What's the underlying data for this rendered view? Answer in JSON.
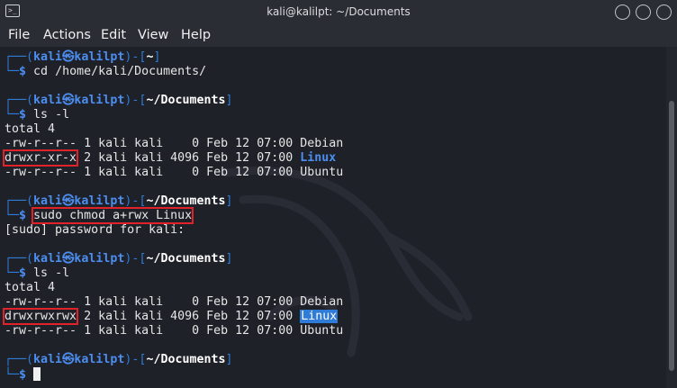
{
  "window": {
    "title": "kali@kalilpt: ~/Documents",
    "icons": [
      "terminal-icon",
      "minimize-icon",
      "maximize-icon",
      "close-icon"
    ]
  },
  "menubar": {
    "items": [
      "File",
      "Actions",
      "Edit",
      "View",
      "Help"
    ]
  },
  "prompt": {
    "user": "kali",
    "at": "㉿",
    "host": "kalilpt",
    "home_dir": "~",
    "docs_dir": "~/Documents",
    "box_top": "┌──(",
    "box_bottom": "└─",
    "dollar": "$"
  },
  "commands": {
    "cd": "cd /home/kali/Documents/",
    "ls1": "ls -l",
    "chmod": "sudo chmod a+rwx Linux",
    "ls2": "ls -l"
  },
  "output1": {
    "total": "total 4",
    "rows": [
      {
        "perm": "-rw-r--r--",
        "rest": " 1 kali kali    0 Feb 12 07:00 ",
        "name": "Debian"
      },
      {
        "perm": "drwxr-xr-x",
        "rest": " 2 kali kali 4096 Feb 12 07:00 ",
        "name": "Linux"
      },
      {
        "perm": "-rw-r--r--",
        "rest": " 1 kali kali    0 Feb 12 07:00 ",
        "name": "Ubuntu"
      }
    ]
  },
  "sudo_prompt": "[sudo] password for kali:",
  "output2": {
    "total": "total 4",
    "rows": [
      {
        "perm": "-rw-r--r--",
        "rest": " 1 kali kali    0 Feb 12 07:00 ",
        "name": "Debian"
      },
      {
        "perm": "drwxrwxrwx",
        "rest": " 2 kali kali 4096 Feb 12 07:00 ",
        "name": "Linux"
      },
      {
        "perm": "-rw-r--r--",
        "rest": " 1 kali kali    0 Feb 12 07:00 ",
        "name": "Ubuntu"
      }
    ]
  },
  "colors": {
    "background": "#1f2129",
    "prompt_blue": "#2f7bd8",
    "highlight_red": "#e0232b"
  }
}
